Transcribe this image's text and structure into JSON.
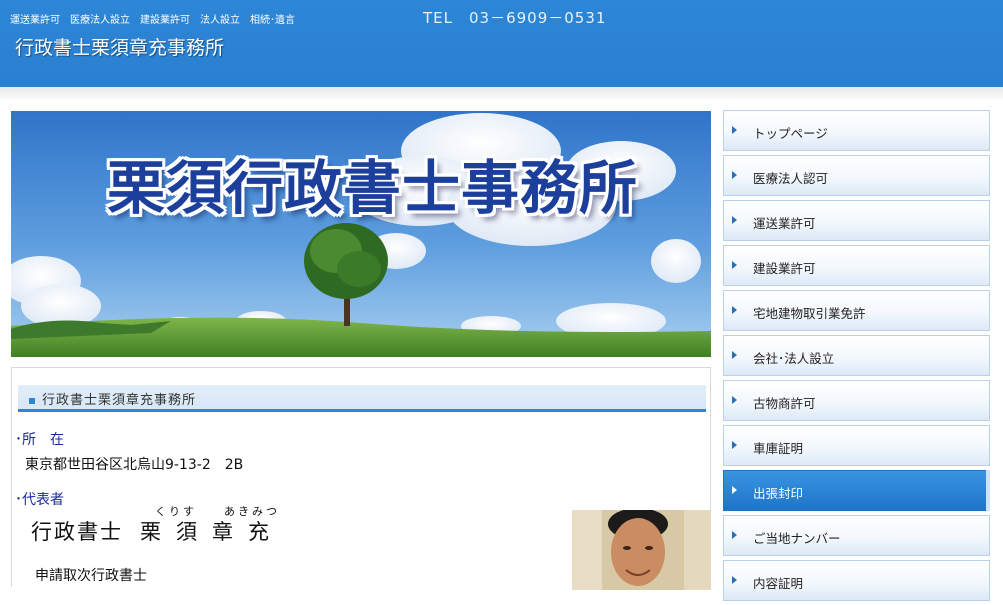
{
  "header": {
    "tags": "運送業許可　医療法人設立　建設業許可　法人設立　相続･遺言",
    "tel": "TEL　03－6909－0531",
    "site_title": "行政書士栗須章充事務所"
  },
  "banner": {
    "title": "栗須行政書士事務所"
  },
  "section": {
    "heading": "行政書士栗須章充事務所",
    "address_label": "･所　在",
    "address_value": "東京都世田谷区北烏山9-13-2　2B",
    "rep_label": "･代表者",
    "rep_title": "行政書士",
    "rep_name_chars": [
      "栗",
      "須",
      "章",
      "充"
    ],
    "ruby_family": "くりす",
    "ruby_given": "あきみつ",
    "rep_role": "申請取次行政書士"
  },
  "nav": {
    "items": [
      {
        "label": "トップページ",
        "active": false
      },
      {
        "label": "医療法人認可",
        "active": false
      },
      {
        "label": "運送業許可",
        "active": false
      },
      {
        "label": "建設業許可",
        "active": false
      },
      {
        "label": "宅地建物取引業免許",
        "active": false
      },
      {
        "label": "会社･法人設立",
        "active": false
      },
      {
        "label": "古物商許可",
        "active": false
      },
      {
        "label": "車庫証明",
        "active": false
      },
      {
        "label": "出張封印",
        "active": true
      },
      {
        "label": "ご当地ナンバー",
        "active": false
      },
      {
        "label": "内容証明",
        "active": false
      }
    ]
  },
  "colors": {
    "header_blue": "#2d86d6",
    "label_blue": "#1a28a0",
    "active_nav": "#1f74c8"
  }
}
